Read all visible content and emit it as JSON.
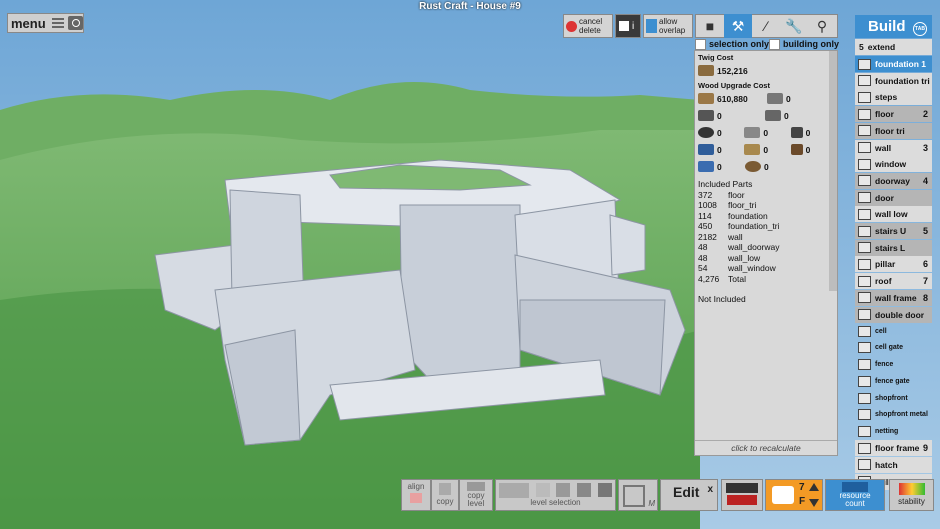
{
  "window": {
    "title": "Rust Craft - House #9"
  },
  "topleft": {
    "menu_label": "menu"
  },
  "toolbar": {
    "cancel_delete": "cancel\ndelete",
    "info_label": "i",
    "allow_overlap": "allow\noverlap"
  },
  "filters": {
    "selection_only": "selection only",
    "building_only": "building only"
  },
  "cost_panel": {
    "twig_heading": "Twig Cost",
    "twig_value": "152,216",
    "wood_heading": "Wood Upgrade Cost",
    "wood_value": "610,880",
    "zero": "0",
    "included_heading": "Included Parts",
    "parts": [
      {
        "count": "372",
        "name": "floor"
      },
      {
        "count": "1008",
        "name": "floor_tri"
      },
      {
        "count": "114",
        "name": "foundation"
      },
      {
        "count": "450",
        "name": "foundation_tri"
      },
      {
        "count": "2182",
        "name": "wall"
      },
      {
        "count": "48",
        "name": "wall_doorway"
      },
      {
        "count": "48",
        "name": "wall_low"
      },
      {
        "count": "54",
        "name": "wall_window"
      },
      {
        "count": "4,276",
        "name": "Total"
      }
    ],
    "not_included": "Not Included",
    "recalc": "click to recalculate"
  },
  "build_menu": {
    "title": "Build",
    "tab_hint": "TAB",
    "extend_num": "5",
    "extend_label": "extend",
    "items": [
      {
        "label": "foundation 1",
        "num": "",
        "style": "sel"
      },
      {
        "label": "foundation tri",
        "num": "",
        "style": "light"
      },
      {
        "label": "steps",
        "num": "",
        "style": "light"
      },
      {
        "label": "floor",
        "num": "2",
        "style": "dark"
      },
      {
        "label": "floor tri",
        "num": "",
        "style": "dark"
      },
      {
        "label": "wall",
        "num": "3",
        "style": "light"
      },
      {
        "label": "window",
        "num": "",
        "style": "light"
      },
      {
        "label": "doorway",
        "num": "4",
        "style": "dark"
      },
      {
        "label": "door",
        "num": "",
        "style": "dark"
      },
      {
        "label": "wall low",
        "num": "",
        "style": "light"
      },
      {
        "label": "stairs U",
        "num": "5",
        "style": "dark"
      },
      {
        "label": "stairs L",
        "num": "",
        "style": "dark"
      },
      {
        "label": "pillar",
        "num": "6",
        "style": "light"
      },
      {
        "label": "roof",
        "num": "7",
        "style": "light"
      },
      {
        "label": "wall frame",
        "num": "8",
        "style": "dark"
      },
      {
        "label": "double door",
        "num": "",
        "style": "dark"
      },
      {
        "label": "cell",
        "num": "",
        "style": "small"
      },
      {
        "label": "cell gate",
        "num": "",
        "style": "small"
      },
      {
        "label": "fence",
        "num": "",
        "style": "small"
      },
      {
        "label": "fence gate",
        "num": "",
        "style": "small"
      },
      {
        "label": "shopfront",
        "num": "",
        "style": "small"
      },
      {
        "label": "shopfront metal",
        "num": "",
        "style": "small"
      },
      {
        "label": "netting",
        "num": "",
        "style": "small"
      },
      {
        "label": "floor frame",
        "num": "9",
        "style": "light"
      },
      {
        "label": "hatch",
        "num": "",
        "style": "light"
      },
      {
        "label": "grill",
        "num": "",
        "style": "light"
      }
    ]
  },
  "bottom_bar": {
    "align": "align",
    "copy": "copy",
    "copy_level": "copy\nlevel",
    "level_selection": "level selection",
    "edit": "Edit",
    "edit_close": "x",
    "edit_key": "M",
    "level_num": "7",
    "level_key": "F",
    "resource_count": "resource\ncount",
    "stability": "stability"
  }
}
